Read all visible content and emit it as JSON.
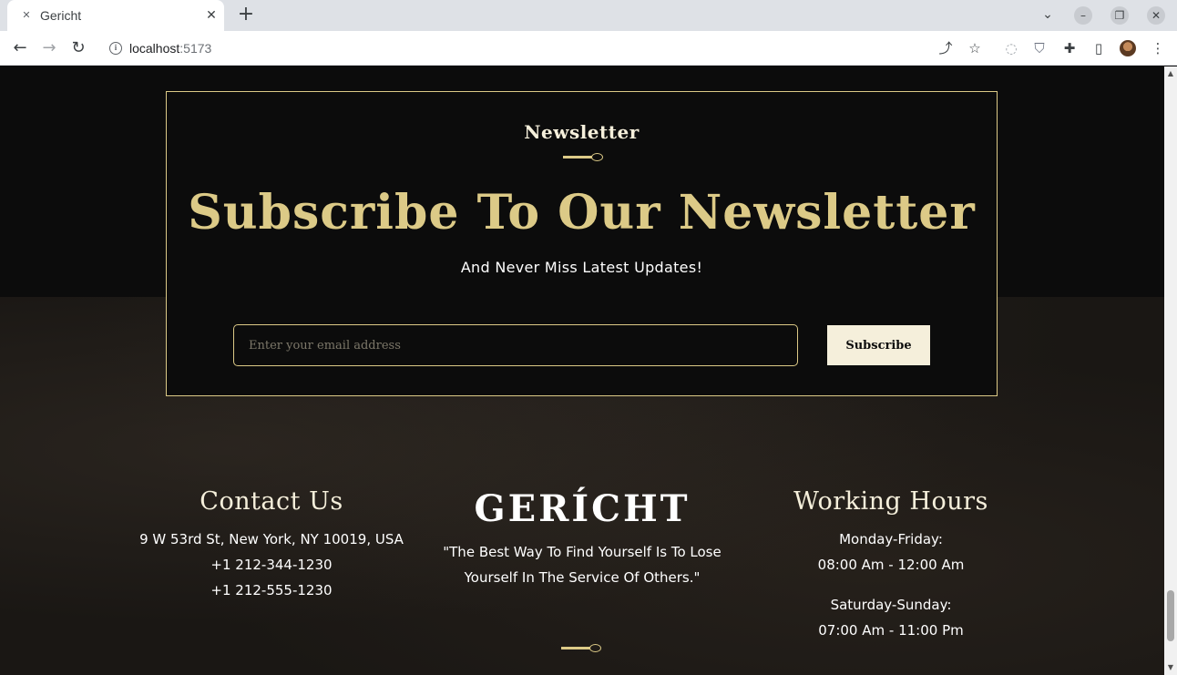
{
  "browser": {
    "tab_title": "Gericht",
    "tab_close": "✕",
    "new_tab": "+",
    "url_host": "localhost",
    "url_port": ":5173",
    "window_buttons": {
      "minimize": "–",
      "restore": "❐",
      "close": "✕"
    }
  },
  "icons": {
    "favicon": "x-icon",
    "back": "back-arrow-icon",
    "forward": "forward-arrow-icon",
    "reload": "reload-icon",
    "share": "share-icon",
    "bookmark": "star-icon",
    "extensions": "puzzle-icon",
    "sidepanel": "side-panel-icon",
    "menu": "kebab-menu-icon"
  },
  "newsletter": {
    "eyebrow": "Newsletter",
    "heading": "Subscribe To Our Newsletter",
    "subheading": "And Never Miss Latest Updates!",
    "email_placeholder": "Enter your email address",
    "email_value": "",
    "subscribe_label": "Subscribe"
  },
  "footer": {
    "contact": {
      "title": "Contact Us",
      "lines": [
        "9 W 53rd St, New York, NY 10019, USA",
        "+1 212-344-1230",
        "+1 212-555-1230"
      ]
    },
    "brand": {
      "logo": "GERÍCHT",
      "quote": "\"The Best Way To Find Yourself Is To Lose Yourself In The Service Of Others.\""
    },
    "hours": {
      "title": "Working Hours",
      "weekday_label": "Monday-Friday:",
      "weekday_time": "08:00 Am - 12:00 Am",
      "weekend_label": "Saturday-Sunday:",
      "weekend_time": "07:00 Am - 11:00 Pm"
    }
  },
  "colors": {
    "gold": "#dcca87",
    "cream": "#f5efdb",
    "black": "#0c0c0c"
  }
}
